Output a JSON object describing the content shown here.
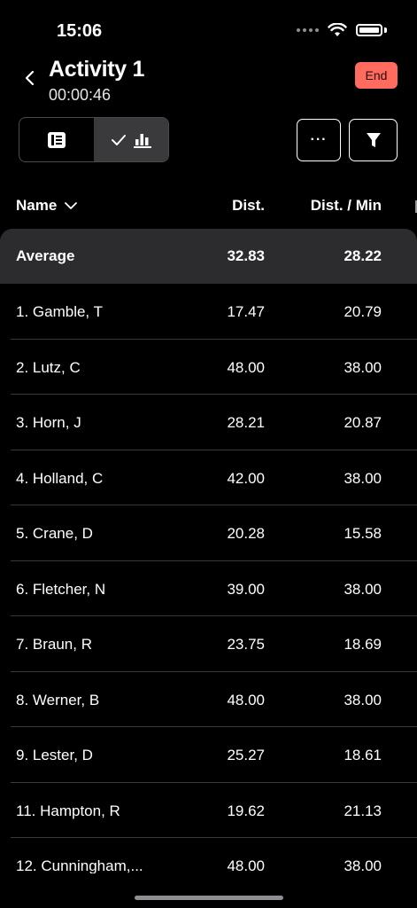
{
  "status_bar": {
    "time": "15:06"
  },
  "header": {
    "title": "Activity 1",
    "elapsed": "00:00:46",
    "end_label": "End",
    "end_color": "#ff6b5f"
  },
  "toolbar": {
    "more_label": "···"
  },
  "table": {
    "columns": {
      "name": "Name",
      "dist": "Dist.",
      "dist_per_min": "Dist. / Min"
    },
    "average": {
      "label": "Average",
      "dist": "32.83",
      "dist_per_min": "28.22"
    },
    "rows": [
      {
        "name": "1. Gamble, T",
        "dist": "17.47",
        "dist_per_min": "20.79"
      },
      {
        "name": "2. Lutz, C",
        "dist": "48.00",
        "dist_per_min": "38.00"
      },
      {
        "name": "3. Horn, J",
        "dist": "28.21",
        "dist_per_min": "20.87"
      },
      {
        "name": "4. Holland, C",
        "dist": "42.00",
        "dist_per_min": "38.00"
      },
      {
        "name": "5. Crane, D",
        "dist": "20.28",
        "dist_per_min": "15.58"
      },
      {
        "name": "6. Fletcher, N",
        "dist": "39.00",
        "dist_per_min": "38.00"
      },
      {
        "name": "7. Braun, R",
        "dist": "23.75",
        "dist_per_min": "18.69"
      },
      {
        "name": "8. Werner, B",
        "dist": "48.00",
        "dist_per_min": "38.00"
      },
      {
        "name": "9. Lester, D",
        "dist": "25.27",
        "dist_per_min": "18.61"
      },
      {
        "name": "11. Hampton, R",
        "dist": "19.62",
        "dist_per_min": "21.13"
      },
      {
        "name": "12. Cunningham,...",
        "dist": "48.00",
        "dist_per_min": "38.00"
      }
    ]
  }
}
